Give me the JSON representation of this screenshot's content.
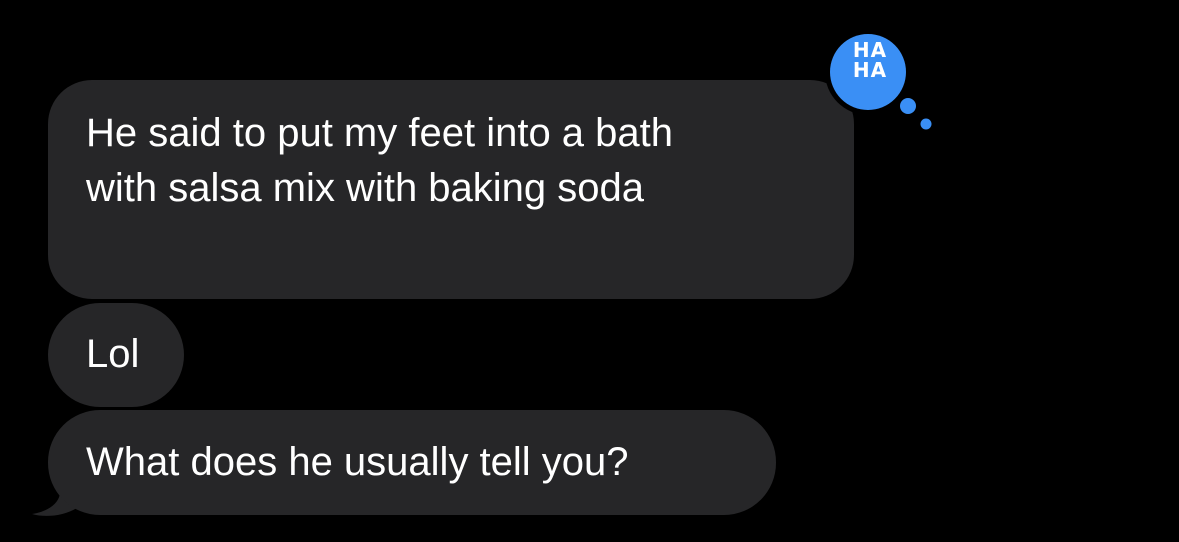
{
  "messages": [
    {
      "text": "He said to put my feet into a bath with salsa mix with baking soda",
      "line1": "He said to put my feet into a bath",
      "line2": "with salsa mix with baking soda"
    },
    {
      "text": "Lol"
    },
    {
      "text": "What does he usually tell you?"
    }
  ],
  "tapback": {
    "icon": "haha-icon",
    "line1": "HA",
    "line2": "HA",
    "color": "#3a8ff5"
  },
  "colors": {
    "background": "#000000",
    "bubble": "#262628",
    "text": "#ffffff"
  }
}
